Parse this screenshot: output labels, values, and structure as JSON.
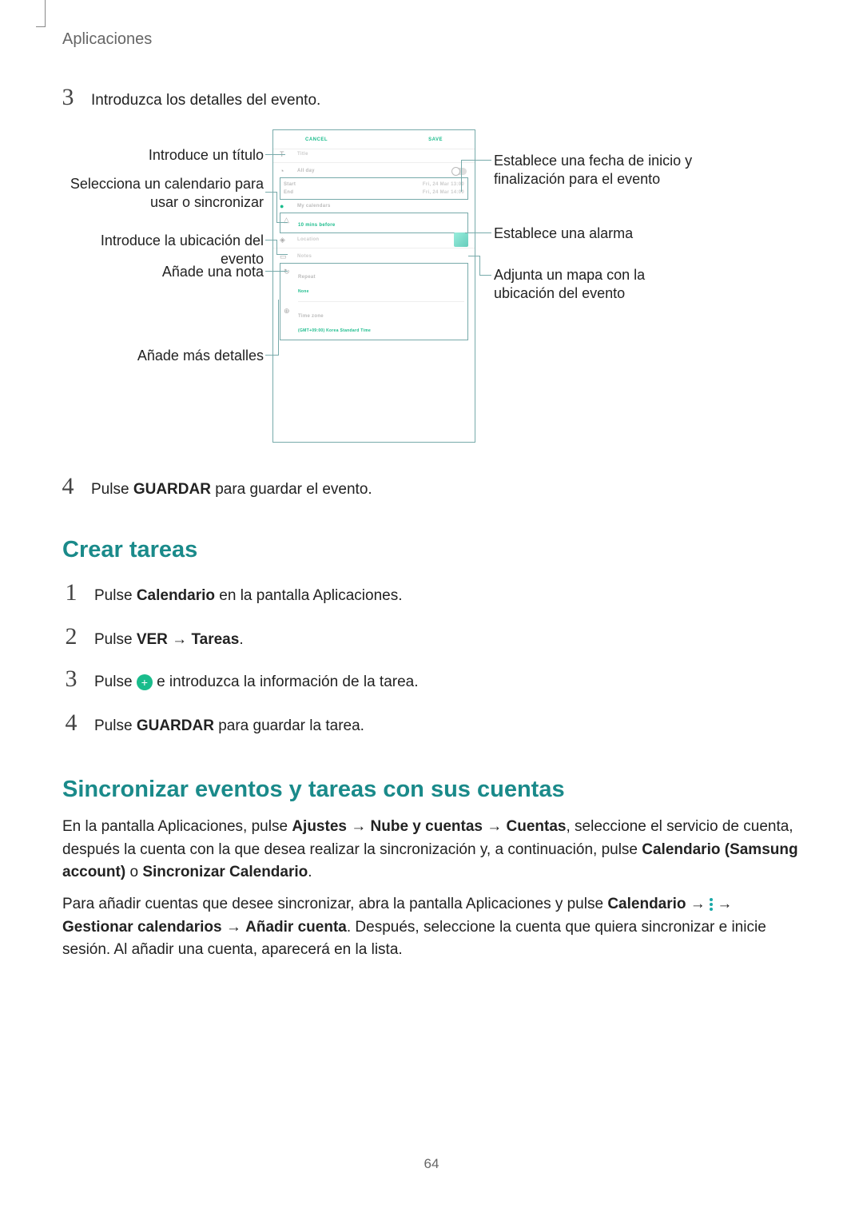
{
  "header": "Aplicaciones",
  "page_number": "64",
  "step3": {
    "num": "3",
    "text": "Introduzca los detalles del evento."
  },
  "step4a": {
    "num": "4",
    "prefix": "Pulse ",
    "bold": "GUARDAR",
    "suffix": " para guardar el evento."
  },
  "section_crear": "Crear tareas",
  "crear_steps": {
    "s1": {
      "num": "1",
      "prefix": "Pulse ",
      "bold": "Calendario",
      "suffix": " en la pantalla Aplicaciones."
    },
    "s2": {
      "num": "2",
      "prefix": "Pulse ",
      "bold1": "VER",
      "arrow": " → ",
      "bold2": "Tareas",
      "dot": "."
    },
    "s3": {
      "num": "3",
      "prefix": "Pulse ",
      "suffix": " e introduzca la información de la tarea."
    },
    "s4": {
      "num": "4",
      "prefix": "Pulse ",
      "bold": "GUARDAR",
      "suffix": " para guardar la tarea."
    }
  },
  "section_sync": "Sincronizar eventos y tareas con sus cuentas",
  "sync_para1": {
    "t1": "En la pantalla Aplicaciones, pulse ",
    "b1": "Ajustes",
    "a1": " → ",
    "b2": "Nube y cuentas",
    "a2": " → ",
    "b3": "Cuentas",
    "t2": ", seleccione el servicio de cuenta, después la cuenta con la que desea realizar la sincronización y, a continuación, pulse ",
    "b4": "Calendario (Samsung account)",
    "t3": " o ",
    "b5": "Sincronizar Calendario",
    "t4": "."
  },
  "sync_para2": {
    "t1": "Para añadir cuentas que desee sincronizar, abra la pantalla Aplicaciones y pulse ",
    "b1": "Calendario",
    "a1": " → ",
    "a2": " → ",
    "b2": "Gestionar calendarios",
    "a3": " → ",
    "b3": "Añadir cuenta",
    "t2": ". Después, seleccione la cuenta que quiera sincronizar e inicie sesión. Al añadir una cuenta, aparecerá en la lista."
  },
  "callouts": {
    "left": {
      "c1": "Introduce un título",
      "c2": "Selecciona un calendario para usar o sincronizar",
      "c3": "Introduce la ubicación del evento",
      "c4": "Añade una nota",
      "c5": "Añade más detalles"
    },
    "right": {
      "c1": "Establece una fecha de inicio y finalización para el evento",
      "c2": "Establece una alarma",
      "c3": "Adjunta un mapa con la ubicación del evento"
    }
  },
  "figure": {
    "cancel": "CANCEL",
    "save": "SAVE",
    "title": "Title",
    "allday": "All day",
    "start": "Start",
    "end": "End",
    "start_date": "Fri, 24 Mar  13:00",
    "end_date": "Fri, 24 Mar  14:00",
    "my_calendars": "My calendars",
    "alarm": "10 mins before",
    "location": "Location",
    "notes": "Notes",
    "repeat": "Repeat",
    "none": "None",
    "timezone": "Time zone",
    "tz_val": "(GMT+09:00) Korea Standard Time"
  }
}
